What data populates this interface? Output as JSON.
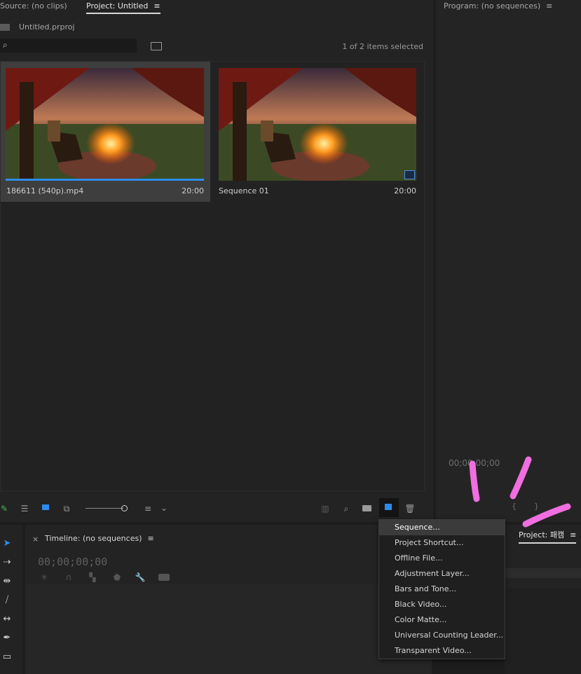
{
  "source_panel": {
    "tab_source": "Source: (no clips)",
    "tab_project": "Project: Untitled"
  },
  "project": {
    "file_name": "Untitled.prproj",
    "search_placeholder": "",
    "selection_status": "1 of 2 items selected",
    "items": [
      {
        "name": "186611 (540p).mp4",
        "duration": "20:00"
      },
      {
        "name": "Sequence 01",
        "duration": "20:00"
      }
    ]
  },
  "program_panel": {
    "tab": "Program: (no sequences)",
    "timecode": "00;00;00;00"
  },
  "timeline": {
    "tab": "Timeline: (no sequences)",
    "timecode": "00;00;00;00",
    "close_label": "×"
  },
  "project2": {
    "tab": "Project: 패캠"
  },
  "new_item_menu": {
    "items": [
      "Sequence...",
      "Project Shortcut...",
      "Offline File...",
      "Adjustment Layer...",
      "Bars and Tone...",
      "Black Video...",
      "Color Matte...",
      "Universal Counting Leader...",
      "Transparent Video..."
    ]
  },
  "colors": {
    "accent_blue": "#2d8ceb",
    "annotation_pink": "#f06ee0",
    "selected_item_bg": "#3e3e3e"
  }
}
